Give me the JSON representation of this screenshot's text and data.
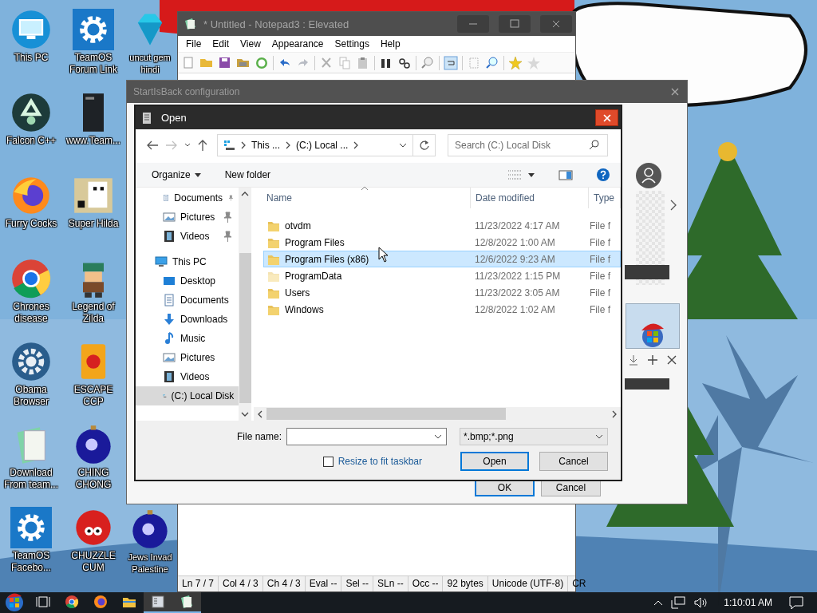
{
  "desktop": {
    "columns": [
      [
        {
          "label": "This PC",
          "kind": "monitor"
        },
        {
          "label": "Falcon C++",
          "kind": "recycle"
        },
        {
          "label": "Furry Cocks",
          "kind": "fox"
        },
        {
          "label": "Chrones disease",
          "kind": "ring"
        },
        {
          "label": "Obama Browser",
          "kind": "gear-round"
        },
        {
          "label": "Download From team...",
          "kind": "notes"
        },
        {
          "label": "TeamOS Facebo...",
          "kind": "gear"
        }
      ],
      [
        {
          "label": "TeamOS Forum Link",
          "kind": "gear"
        },
        {
          "label": "www.Team...",
          "kind": "book"
        },
        {
          "label": "Super Hilda",
          "kind": "pixel"
        },
        {
          "label": "Legend of Zilda",
          "kind": "hero"
        },
        {
          "label": "ESCAPE CCP",
          "kind": "box"
        },
        {
          "label": "CHING CHONG",
          "kind": "orb"
        },
        {
          "label": "CHUZZLE CUM",
          "kind": "fuzz"
        }
      ],
      [
        {
          "label": "uncut gem hindi",
          "kind": "gem"
        },
        {
          "label": "Jews Invad Palestine",
          "kind": "orb"
        }
      ]
    ]
  },
  "notepad": {
    "title": "* Untitled - Notepad3 : Elevated",
    "menu": [
      "File",
      "Edit",
      "View",
      "Appearance",
      "Settings",
      "Help"
    ],
    "status": [
      "Ln 7 / 7",
      "Col 4 / 3",
      "Ch 4 / 3",
      "Eval --",
      "Sel --",
      "SLn --",
      "Occ --",
      "92 bytes",
      "Unicode (UTF-8)",
      "CR"
    ]
  },
  "startisback": {
    "title": "StartIsBack configuration",
    "buttons": [
      {
        "label": "OK",
        "default": true
      },
      {
        "label": "Cancel",
        "default": false
      }
    ]
  },
  "open_dialog": {
    "title": "Open",
    "breadcrumb": [
      "This ...",
      "(C:) Local ..."
    ],
    "search": {
      "placeholder": "Search (C:) Local Disk"
    },
    "toolbar": [
      "Organize",
      "New folder"
    ],
    "nav": {
      "quick_access": [
        {
          "label": "Documents",
          "kind": "document",
          "pinned": true,
          "selected": false
        },
        {
          "label": "Pictures",
          "kind": "picture",
          "pinned": true,
          "selected": false
        },
        {
          "label": "Videos",
          "kind": "video",
          "pinned": true,
          "selected": false
        }
      ],
      "tree": [
        {
          "label": "This PC",
          "kind": "pc",
          "selected": false,
          "children": [
            {
              "label": "Desktop",
              "kind": "desktop",
              "selected": false
            },
            {
              "label": "Documents",
              "kind": "document",
              "selected": false
            },
            {
              "label": "Downloads",
              "kind": "download",
              "selected": false
            },
            {
              "label": "Music",
              "kind": "music",
              "selected": false
            },
            {
              "label": "Pictures",
              "kind": "picture",
              "selected": false
            },
            {
              "label": "Videos",
              "kind": "video",
              "selected": false
            },
            {
              "label": "(C:) Local Disk",
              "kind": "disk",
              "selected": true
            }
          ]
        }
      ]
    },
    "columns": [
      "Name",
      "Date modified",
      "Type"
    ],
    "files": [
      {
        "name": "otvdm",
        "date": "11/23/2022 4:17 AM",
        "type": "File f",
        "hidden": false,
        "selected": false
      },
      {
        "name": "Program Files",
        "date": "12/8/2022 1:00 AM",
        "type": "File f",
        "hidden": false,
        "selected": false
      },
      {
        "name": "Program Files (x86)",
        "date": "12/6/2022 9:23 AM",
        "type": "File f",
        "hidden": false,
        "selected": true
      },
      {
        "name": "ProgramData",
        "date": "11/23/2022 1:15 PM",
        "type": "File f",
        "hidden": true,
        "selected": false
      },
      {
        "name": "Users",
        "date": "11/23/2022 3:05 AM",
        "type": "File f",
        "hidden": false,
        "selected": false
      },
      {
        "name": "Windows",
        "date": "12/8/2022 1:02 AM",
        "type": "File f",
        "hidden": false,
        "selected": false
      }
    ],
    "file_name_label": "File name:",
    "filter": "*.bmp;*.png",
    "checkbox": {
      "label": "Resize to fit taskbar",
      "checked": false
    },
    "buttons": [
      {
        "label": "Open",
        "default": true
      },
      {
        "label": "Cancel",
        "default": false
      }
    ]
  },
  "taskbar": {
    "apps": [
      {
        "kind": "start",
        "running": false
      },
      {
        "kind": "taskview",
        "running": false
      },
      {
        "kind": "chrome",
        "running": false
      },
      {
        "kind": "firefox",
        "running": false
      },
      {
        "kind": "explorer",
        "running": false
      },
      {
        "kind": "config",
        "running": true
      },
      {
        "kind": "notepad",
        "running": true
      }
    ],
    "clock": "1:10:01 AM"
  }
}
